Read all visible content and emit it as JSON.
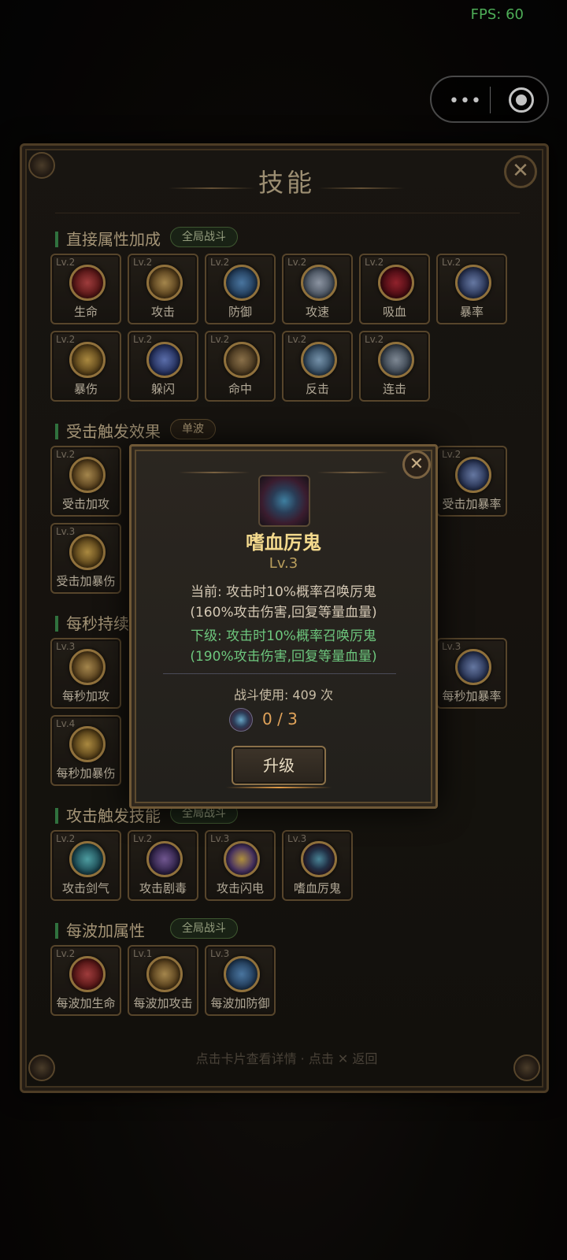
{
  "status": {
    "fps": "FPS: 60"
  },
  "capsule": {
    "more": "•••"
  },
  "panel": {
    "title": "技能",
    "close": "✕",
    "footer_hint": "点击卡片查看详情 · 点击 ✕ 返回"
  },
  "sections": [
    {
      "title": "直接属性加成",
      "tag": "全局战斗",
      "cards": [
        {
          "lv": "Lv.2",
          "name": "生命",
          "color": "#8b2b2b"
        },
        {
          "lv": "Lv.2",
          "name": "攻击",
          "color": "#8c6a2e"
        },
        {
          "lv": "Lv.2",
          "name": "防御",
          "color": "#2f5e8a"
        },
        {
          "lv": "Lv.2",
          "name": "攻速",
          "color": "#6d7b8c"
        },
        {
          "lv": "Lv.2",
          "name": "吸血",
          "color": "#6e1720"
        },
        {
          "lv": "Lv.2",
          "name": "暴率",
          "color": "#3b4f7a"
        },
        {
          "lv": "Lv.2",
          "name": "暴伤",
          "color": "#8a7030"
        },
        {
          "lv": "Lv.2",
          "name": "躲闪",
          "color": "#3c4f86"
        },
        {
          "lv": "Lv.2",
          "name": "命中",
          "color": "#6a5536"
        },
        {
          "lv": "Lv.2",
          "name": "反击",
          "color": "#4a6a82"
        },
        {
          "lv": "Lv.2",
          "name": "连击",
          "color": "#4d5a6a"
        }
      ]
    },
    {
      "title": "受击触发效果",
      "tag": "单波",
      "cards": [
        {
          "lv": "Lv.2",
          "name": "受击加攻",
          "color": "#8c6a2e"
        },
        {
          "lv": "Lv.2",
          "name": "受击加暴率",
          "color": "#3b4f7a"
        },
        {
          "lv": "Lv.3",
          "name": "受击加暴伤",
          "color": "#8a7030"
        }
      ]
    },
    {
      "title": "每秒持续效果",
      "tag": "",
      "cards": [
        {
          "lv": "Lv.3",
          "name": "每秒加攻",
          "color": "#8c6a2e"
        },
        {
          "lv": "Lv.3",
          "name": "每秒加暴率",
          "color": "#3b4f7a"
        },
        {
          "lv": "Lv.4",
          "name": "每秒加暴伤",
          "color": "#8a7030"
        }
      ]
    },
    {
      "title": "攻击触发技能",
      "tag": "全局战斗",
      "cards": [
        {
          "lv": "Lv.2",
          "name": "攻击剑气",
          "color": "#2c6f7a"
        },
        {
          "lv": "Lv.2",
          "name": "攻击剧毒",
          "color": "#4a3a6a"
        },
        {
          "lv": "Lv.3",
          "name": "攻击闪电",
          "color": "#4d3a6e"
        },
        {
          "lv": "Lv.3",
          "name": "嗜血厉鬼",
          "color": "#2b5a6c"
        }
      ]
    },
    {
      "title": "每波加属性",
      "tag": "全局战斗",
      "cards": [
        {
          "lv": "Lv.2",
          "name": "每波加生命",
          "color": "#8b2b2b"
        },
        {
          "lv": "Lv.1",
          "name": "每波加攻击",
          "color": "#8c6a2e"
        },
        {
          "lv": "Lv.3",
          "name": "每波加防御",
          "color": "#2f5e8a"
        }
      ]
    }
  ],
  "dialog": {
    "close": "✕",
    "name": "嗜血厉鬼",
    "level": "Lv.3",
    "current_line1": "当前: 攻击时10%概率召唤厉鬼",
    "current_line2": "(160%攻击伤害,回复等量血量)",
    "next_line1": "下级: 攻击时10%概率召唤厉鬼",
    "next_line2": "(190%攻击伤害,回复等量血量)",
    "usage": "战斗使用: 409 次",
    "cost": "0 / 3",
    "upgrade_label": "升级"
  }
}
